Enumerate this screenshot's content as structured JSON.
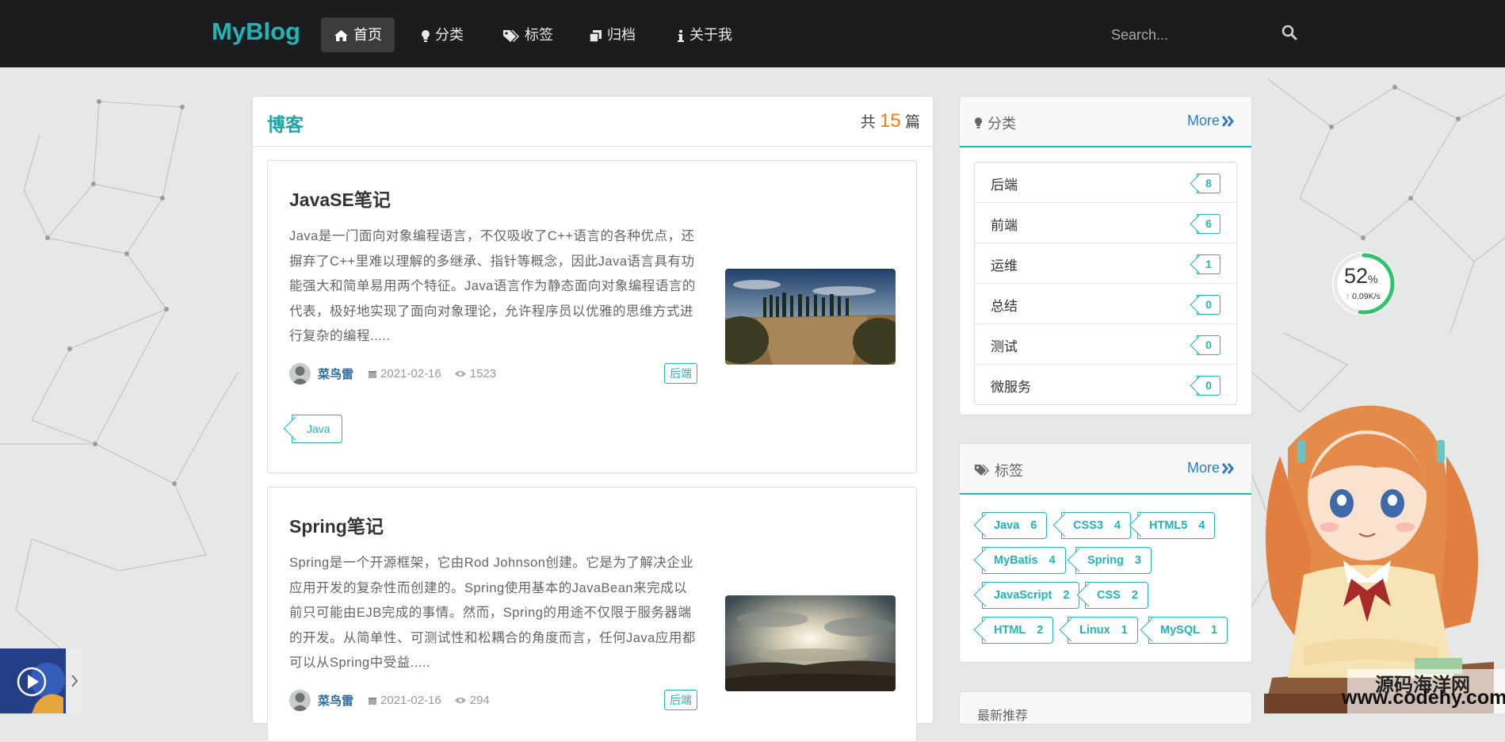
{
  "navbar": {
    "brand": "MyBlog",
    "items": [
      {
        "label": "首页",
        "icon": "home-icon",
        "active": true
      },
      {
        "label": "分类",
        "icon": "lightbulb-icon",
        "active": false
      },
      {
        "label": "标签",
        "icon": "tags-icon",
        "active": false
      },
      {
        "label": "归档",
        "icon": "clone-icon",
        "active": false
      },
      {
        "label": "关于我",
        "icon": "info-icon",
        "active": false
      }
    ],
    "search_placeholder": "Search..."
  },
  "main": {
    "title": "博客",
    "count_prefix": "共",
    "count": "15",
    "count_suffix": "篇",
    "posts": [
      {
        "title": "JavaSE笔记",
        "body": "Java是一门面向对象编程语言，不仅吸收了C++语言的各种优点，还摒弃了C++里难以理解的多继承、指针等概念，因此Java语言具有功能强大和简单易用两个特征。Java语言作为静态面向对象编程语言的代表，极好地实现了面向对象理论，允许程序员以优雅的思维方式进行复杂的编程.....",
        "author": "菜鸟雷",
        "date": "2021-02-16",
        "views": "1523",
        "category": "后端",
        "tag": "Java"
      },
      {
        "title": "Spring笔记",
        "body": "Spring是一个开源框架，它由Rod Johnson创建。它是为了解决企业应用开发的复杂性而创建的。Spring使用基本的JavaBean来完成以前只可能由EJB完成的事情。然而，Spring的用途不仅限于服务器端的开发。从简单性、可测试性和松耦合的角度而言，任何Java应用都可以从Spring中受益.....",
        "author": "菜鸟雷",
        "date": "2021-02-16",
        "views": "294",
        "category": "后端"
      }
    ]
  },
  "sidebar": {
    "categories": {
      "title": "分类",
      "more": "More",
      "items": [
        {
          "name": "后端",
          "count": "8"
        },
        {
          "name": "前端",
          "count": "6"
        },
        {
          "name": "运维",
          "count": "1"
        },
        {
          "name": "总结",
          "count": "0"
        },
        {
          "name": "测试",
          "count": "0"
        },
        {
          "name": "微服务",
          "count": "0"
        }
      ]
    },
    "tags": {
      "title": "标签",
      "more": "More",
      "items": [
        {
          "name": "Java",
          "count": "6"
        },
        {
          "name": "CSS3",
          "count": "4"
        },
        {
          "name": "HTML5",
          "count": "4"
        },
        {
          "name": "MyBatis",
          "count": "4"
        },
        {
          "name": "Spring",
          "count": "3"
        },
        {
          "name": "JavaScript",
          "count": "2"
        },
        {
          "name": "CSS",
          "count": "2"
        },
        {
          "name": "HTML",
          "count": "2"
        },
        {
          "name": "Linux",
          "count": "1"
        },
        {
          "name": "MySQL",
          "count": "1"
        }
      ]
    },
    "recommend": {
      "title": "最新推荐"
    }
  },
  "widgets": {
    "net_percent": "52",
    "net_unit": "%",
    "net_speed": "0.09K/s",
    "watermark_cn": "源码海洋网",
    "watermark_url": "www.codehy.com"
  },
  "colors": {
    "accent": "#22b5b5",
    "nav_bg": "#1b1c1d",
    "count_orange": "#ef7f12",
    "link_blue": "#2f7dc0"
  }
}
